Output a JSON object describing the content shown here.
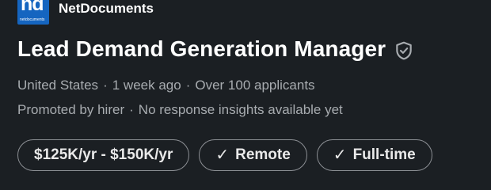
{
  "company": {
    "logo_text": "nd",
    "logo_subtext": "netdocuments",
    "name": "NetDocuments"
  },
  "job": {
    "title": "Lead Demand Generation Manager",
    "location": "United States",
    "posted": "1 week ago",
    "applicants": "Over 100 applicants",
    "promoted": "Promoted by hirer",
    "insights": "No response insights available yet"
  },
  "separator": "·",
  "pills": {
    "salary": "$125K/yr - $150K/yr",
    "remote": "Remote",
    "fulltime": "Full-time"
  },
  "icons": {
    "verified": "shield-check-icon",
    "check": "check-icon"
  },
  "colors": {
    "background": "#1b1f23",
    "logo_blue": "#1565c0",
    "secondary_text": "#a8acb0"
  }
}
